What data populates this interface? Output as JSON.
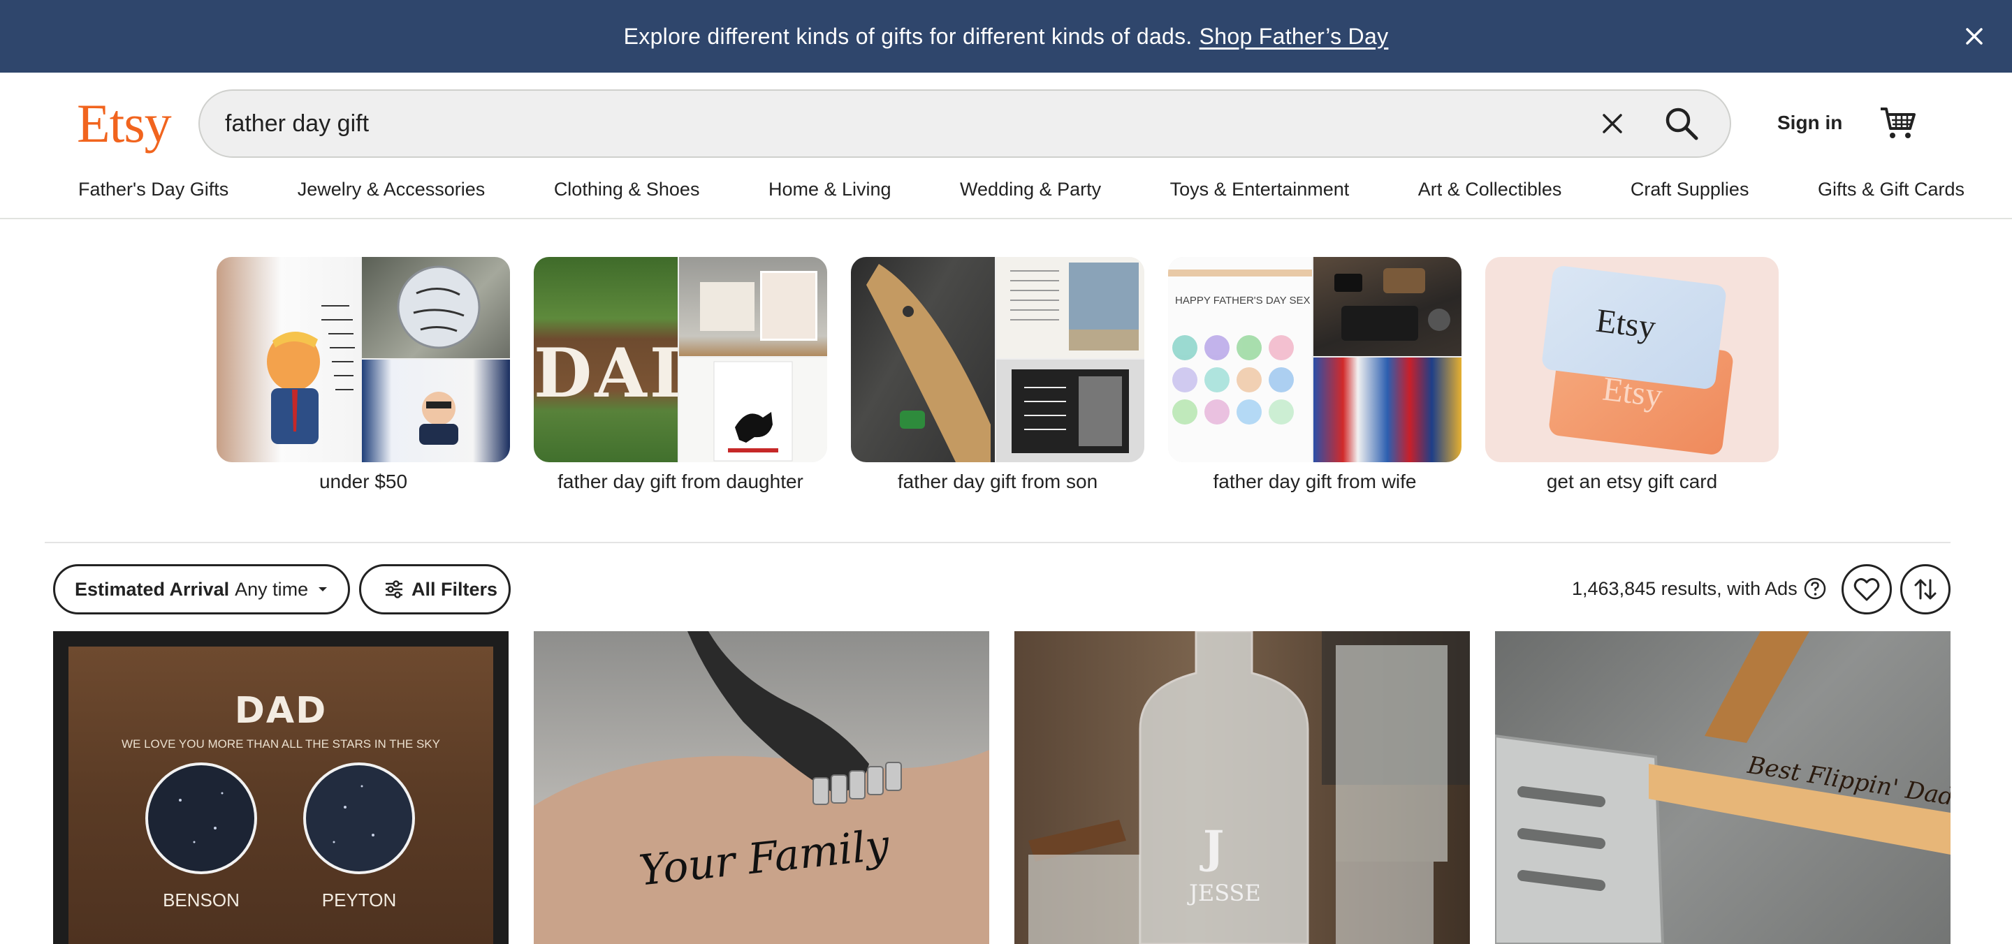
{
  "banner": {
    "message": "Explore different kinds of gifts for different kinds of dads.",
    "link": "Shop Father’s Day"
  },
  "header": {
    "logo": "Etsy",
    "search_value": "father day gift",
    "sign_in": "Sign in"
  },
  "nav": [
    "Father's Day Gifts",
    "Jewelry & Accessories",
    "Clothing & Shoes",
    "Home & Living",
    "Wedding & Party",
    "Toys & Entertainment",
    "Art & Collectibles",
    "Craft Supplies",
    "Gifts & Gift Cards"
  ],
  "tiles": [
    {
      "caption": "under $50"
    },
    {
      "caption": "father day gift from daughter",
      "text": "DAD"
    },
    {
      "caption": "father day gift from son"
    },
    {
      "caption": "father day gift from wife",
      "text": "HAPPY FATHER'S DAY SEX"
    },
    {
      "caption": "get an etsy gift card",
      "card_top": "Etsy",
      "card_bottom": "Etsy"
    }
  ],
  "filters": {
    "arrival_label": "Estimated Arrival",
    "arrival_value": "Any time",
    "all_filters": "All Filters",
    "results": "1,463,845 results, with Ads"
  },
  "listings": [
    {
      "title": "DAD",
      "subtitle": "WE LOVE YOU MORE THAN ALL THE STARS IN THE SKY",
      "name1": "BENSON",
      "name2": "PEYTON"
    },
    {
      "script": "Your Family"
    },
    {
      "letter": "J",
      "name": "JESSE"
    },
    {
      "engraving": "Best Flippin' Dad!"
    }
  ],
  "colors": {
    "brand": "#f1641e",
    "banner": "#2f466c"
  }
}
